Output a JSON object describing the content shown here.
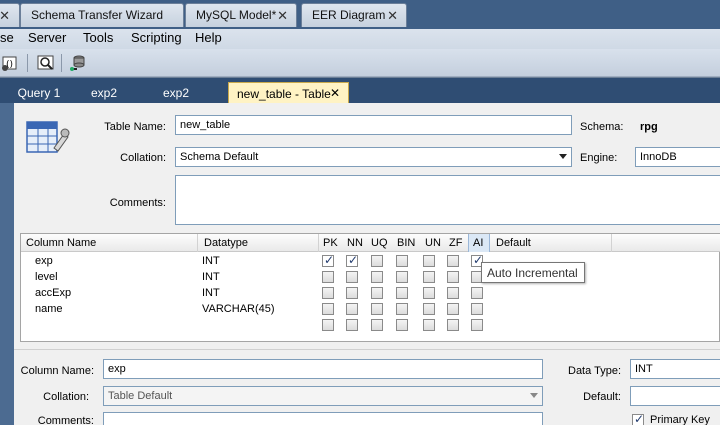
{
  "doc_tabs": [
    {
      "label": "Schema Transfer Wizard"
    },
    {
      "label": "MySQL Model*"
    },
    {
      "label": "EER Diagram"
    }
  ],
  "menu": [
    "se",
    "Server",
    "Tools",
    "Scripting",
    "Help"
  ],
  "editor_tabs": [
    {
      "label": "Query 1"
    },
    {
      "label": "exp2"
    },
    {
      "label": "exp2"
    },
    {
      "label": "new_table - Table"
    }
  ],
  "table": {
    "name_label": "Table Name:",
    "name_value": "new_table",
    "schema_label": "Schema:",
    "schema_value": "rpg",
    "collation_label": "Collation:",
    "collation_value": "Schema Default",
    "engine_label": "Engine:",
    "engine_value": "InnoDB",
    "comments_label": "Comments:"
  },
  "grid": {
    "headers": [
      "Column Name",
      "Datatype",
      "PK",
      "NN",
      "UQ",
      "BIN",
      "UN",
      "ZF",
      "AI",
      "Default"
    ],
    "rows": [
      {
        "name": "exp",
        "type": "INT",
        "flags": [
          true,
          true,
          false,
          false,
          false,
          false,
          true
        ]
      },
      {
        "name": "level",
        "type": "INT",
        "flags": [
          false,
          false,
          false,
          false,
          false,
          false,
          false
        ]
      },
      {
        "name": "accExp",
        "type": "INT",
        "flags": [
          false,
          false,
          false,
          false,
          false,
          false,
          false
        ]
      },
      {
        "name": "name",
        "type": "VARCHAR(45)",
        "flags": [
          false,
          false,
          false,
          false,
          false,
          false,
          false
        ]
      },
      {
        "name": "",
        "type": "",
        "flags": [
          false,
          false,
          false,
          false,
          false,
          false,
          false
        ]
      }
    ]
  },
  "tooltip": "Auto Incremental",
  "detail": {
    "column_name_label": "Column Name:",
    "column_name_value": "exp",
    "data_type_label": "Data Type:",
    "data_type_value": "INT",
    "collation_label": "Collation:",
    "collation_value": "Table Default",
    "default_label": "Default:",
    "comments_label": "Comments:",
    "primary_key_label": "Primary Key"
  }
}
